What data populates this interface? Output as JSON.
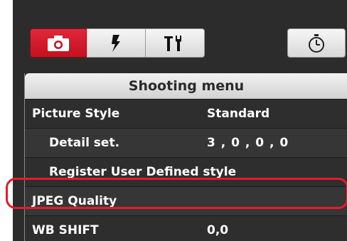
{
  "toolbar": {
    "tabs": [
      {
        "icon": "camera-icon",
        "active": true,
        "color": "#d11a2a"
      },
      {
        "icon": "flash-icon",
        "active": false
      },
      {
        "icon": "tools-icon",
        "active": false
      }
    ],
    "timer_icon": "timer-icon"
  },
  "menu": {
    "header": "Shooting menu",
    "rows": [
      {
        "label": "Picture Style",
        "value": "Standard"
      },
      {
        "label": "Detail set.",
        "value": "3 , 0 , 0 , 0"
      },
      {
        "label": "Register User Defined style",
        "value": ""
      },
      {
        "label": "JPEG Quality",
        "value": ""
      },
      {
        "label": "WB SHIFT",
        "value": "0,0"
      }
    ]
  },
  "highlight_color": "#e41b2a"
}
